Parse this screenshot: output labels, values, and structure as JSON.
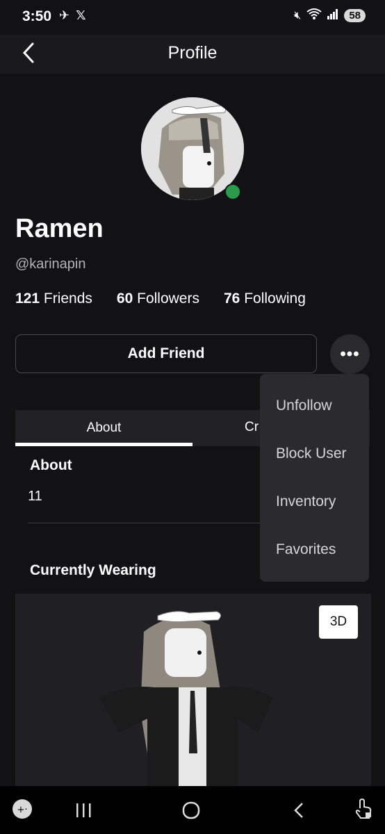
{
  "status_bar": {
    "time": "3:50",
    "battery": "58",
    "icons": [
      "android-icon",
      "x-logo-icon",
      "mute-icon",
      "wifi-icon",
      "signal-icon"
    ]
  },
  "header": {
    "title": "Profile",
    "back_icon": "chevron-left-icon"
  },
  "profile": {
    "display_name": "Ramen",
    "username": "@karinapin",
    "online_status_color": "#2b9a4a",
    "stats": [
      {
        "count": "121",
        "label": "Friends"
      },
      {
        "count": "60",
        "label": "Followers"
      },
      {
        "count": "76",
        "label": "Following"
      }
    ]
  },
  "actions": {
    "add_friend_label": "Add Friend",
    "more_label": "•••"
  },
  "tabs": {
    "about_label": "About",
    "creations_label_visible": "Cr"
  },
  "about": {
    "heading": "About",
    "value": "11"
  },
  "wearing": {
    "heading": "Currently Wearing",
    "view_3d_label": "3D"
  },
  "menu": {
    "items": [
      "Unfollow",
      "Block User",
      "Inventory",
      "Favorites"
    ]
  },
  "colors": {
    "background": "#121215",
    "header_bg": "#1a1a1e",
    "menu_bg": "#2a2a2f",
    "online": "#2b9a4a"
  },
  "nav_bar": {
    "icons": [
      "gamepad-icon",
      "recents-icon",
      "home-icon",
      "back-icon",
      "touch-lock-icon"
    ]
  }
}
